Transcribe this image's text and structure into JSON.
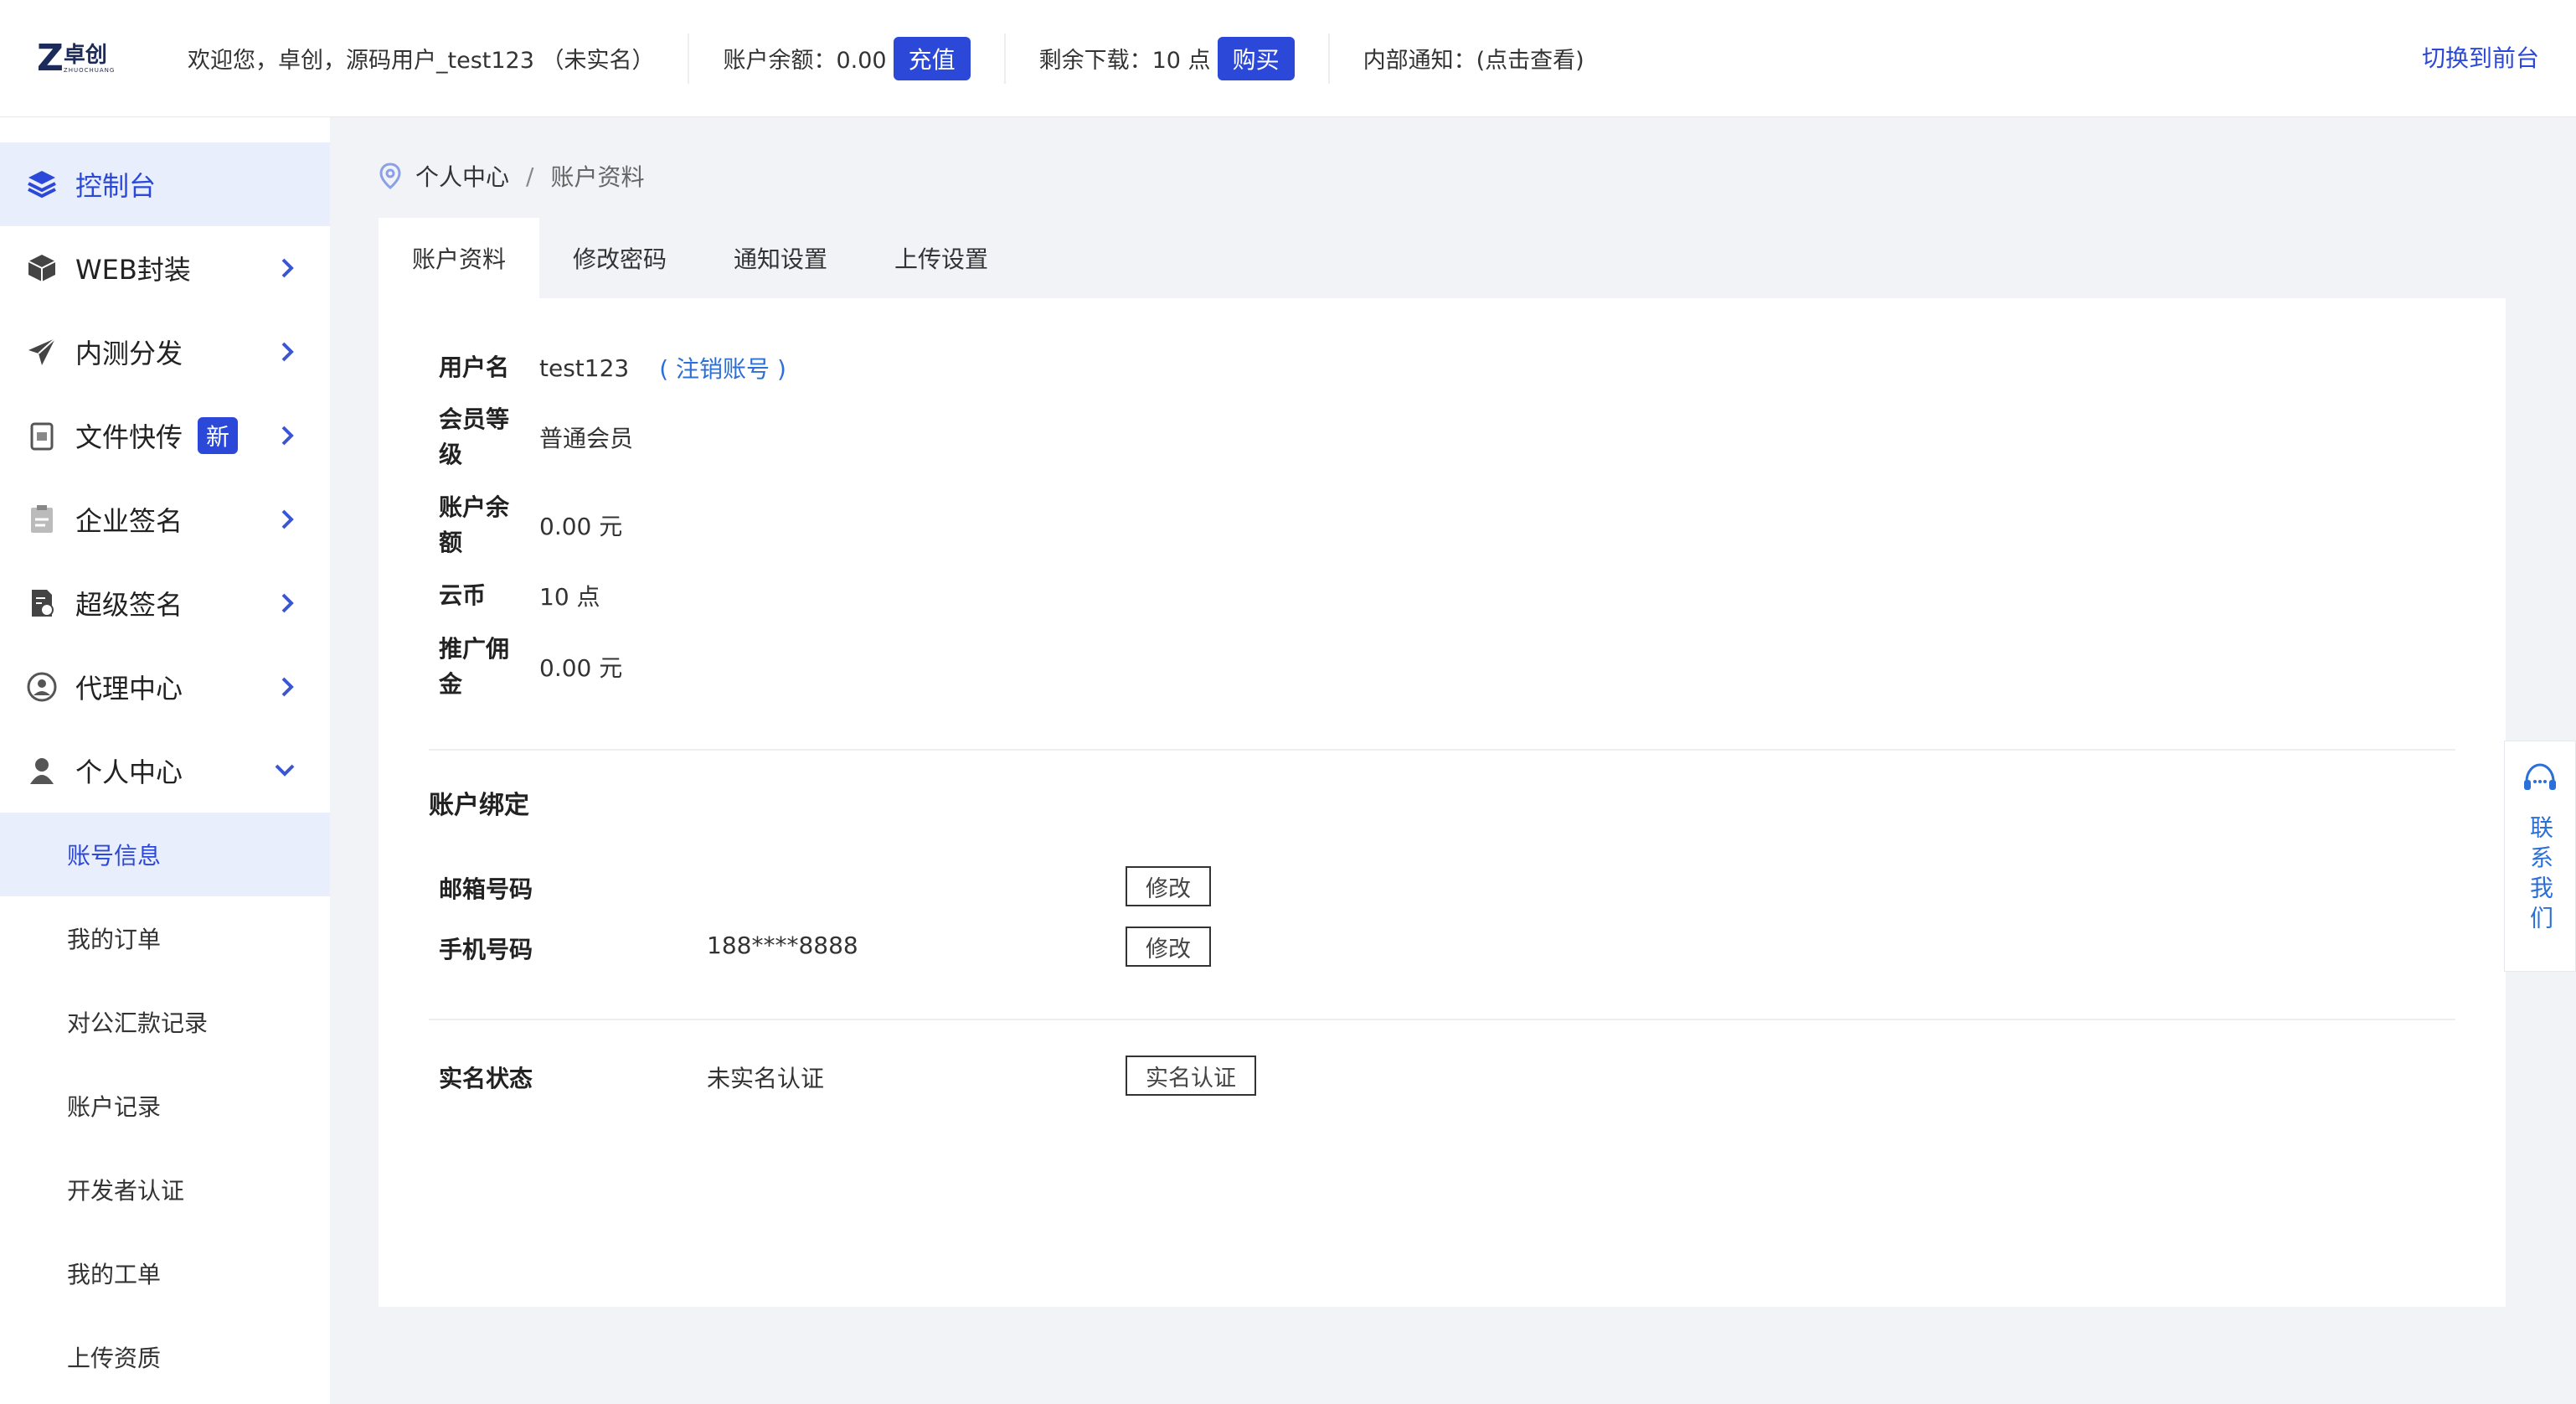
{
  "topbar": {
    "logo_cn": "卓创",
    "logo_en": "ZHUOCHUANG",
    "welcome": "欢迎您，卓创，源码用户_test123 （未实名）",
    "balance_label": "账户余额：0.00",
    "recharge_btn": "充值",
    "downloads_label": "剩余下载：10 点",
    "buy_btn": "购买",
    "notice": "内部通知：(点击查看)",
    "switch_front": "切换到前台"
  },
  "sidebar": {
    "items": [
      {
        "label": "控制台"
      },
      {
        "label": "WEB封装"
      },
      {
        "label": "内测分发"
      },
      {
        "label": "文件快传",
        "badge": "新"
      },
      {
        "label": "企业签名"
      },
      {
        "label": "超级签名"
      },
      {
        "label": "代理中心"
      },
      {
        "label": "个人中心"
      }
    ],
    "subitems": [
      {
        "label": "账号信息"
      },
      {
        "label": "我的订单"
      },
      {
        "label": "对公汇款记录"
      },
      {
        "label": "账户记录"
      },
      {
        "label": "开发者认证"
      },
      {
        "label": "我的工单"
      },
      {
        "label": "上传资质"
      }
    ]
  },
  "breadcrumb": {
    "parent": "个人中心",
    "sep": "/",
    "current": "账户资料"
  },
  "tabs": [
    "账户资料",
    "修改密码",
    "通知设置",
    "上传设置"
  ],
  "account": {
    "username_label": "用户名",
    "username": "test123",
    "cancel_link": "( 注销账号 )",
    "level_label_1": "会员等",
    "level_label_2": "级",
    "level": "普通会员",
    "balance_label_1": "账户余",
    "balance_label_2": "额",
    "balance": "0.00 元",
    "coin_label": "云币",
    "coin": "10 点",
    "commission_label_1": "推广佣",
    "commission_label_2": "金",
    "commission": "0.00 元"
  },
  "binding": {
    "title": "账户绑定",
    "email_label": "邮箱号码",
    "email": "",
    "email_btn": "修改",
    "phone_label": "手机号码",
    "phone": "188****8888",
    "phone_btn": "修改",
    "realname_label": "实名状态",
    "realname": "未实名认证",
    "realname_btn": "实名认证"
  },
  "contact": {
    "label": "联系我们"
  }
}
